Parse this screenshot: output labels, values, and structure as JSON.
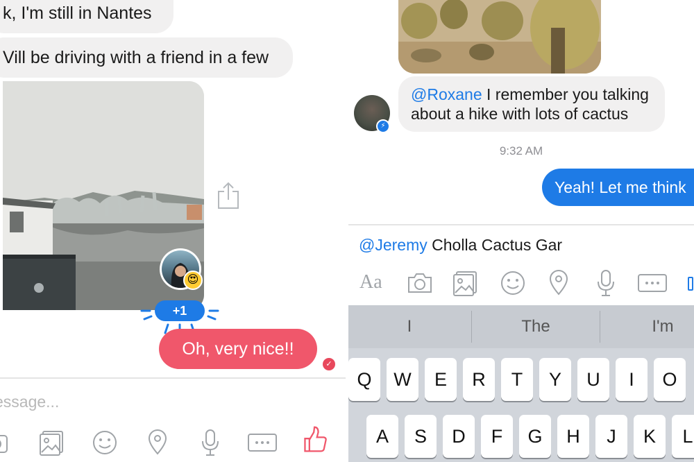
{
  "left": {
    "messages": [
      "k, I'm still in Nantes",
      "Vill be driving with a friend in a few"
    ],
    "reaction_count": "+1",
    "reaction_emoji": "😍",
    "sent_message": "Oh, very nice!!",
    "seen_check": "✓",
    "input_placeholder": "essage...",
    "accent": "#f0576b"
  },
  "right": {
    "incoming": {
      "mention": "@Roxane",
      "line1": " I remember you talking",
      "line2": "about a hike with lots of cactus"
    },
    "timestamp": "9:32 AM",
    "outgoing": "Yeah! Let me think",
    "compose": {
      "mention": "@Jeremy",
      "text": " Cholla Cactus Gar"
    },
    "tools": {
      "text_format": "Aa"
    },
    "suggestions": [
      "I",
      "The",
      "I'm"
    ],
    "keys_row1": [
      "Q",
      "W",
      "E",
      "R",
      "T",
      "Y",
      "U",
      "I",
      "O"
    ],
    "keys_row2": [
      "A",
      "S",
      "D",
      "F",
      "G",
      "H",
      "J",
      "K",
      "L"
    ],
    "accent": "#1e7be6"
  },
  "icons": [
    "camera-icon",
    "gallery-icon",
    "emoji-icon",
    "location-icon",
    "microphone-icon",
    "more-icon",
    "thumbs-up-icon",
    "share-icon",
    "messenger-badge-icon"
  ]
}
